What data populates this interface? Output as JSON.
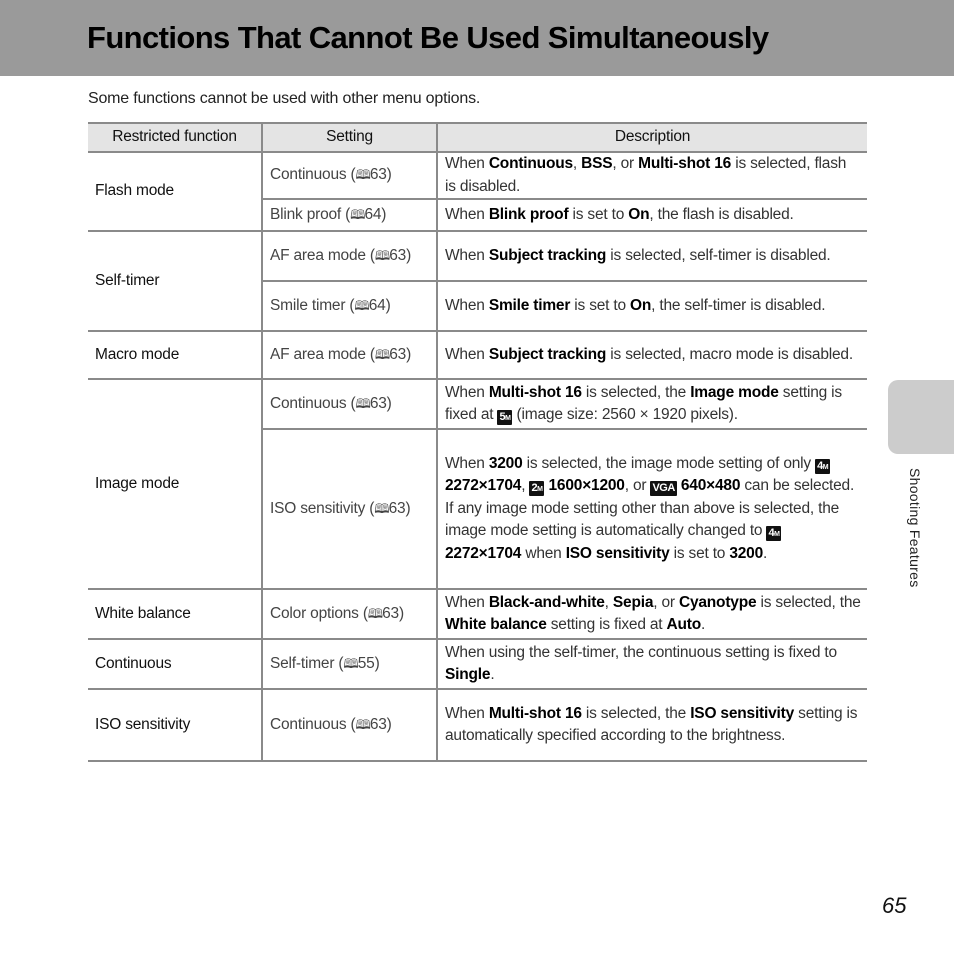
{
  "header": {
    "title": "Functions That Cannot Be Used Simultaneously"
  },
  "intro": "Some functions cannot be used with other menu options.",
  "table": {
    "columns": [
      "Restricted function",
      "Setting",
      "Description"
    ],
    "groups": [
      {
        "function": "Flash mode",
        "rows": [
          {
            "setting": "Continuous (",
            "page": "63",
            "desc_html": "When <b>Continuous</b>, <b>BSS</b>, or <b>Multi-shot 16</b> is selected, flash is disabled."
          },
          {
            "setting": "Blink proof (",
            "page": "64",
            "desc_html": "When <b>Blink proof</b> is set to <b>On</b>, the flash is disabled."
          }
        ]
      },
      {
        "function": "Self-timer",
        "rows": [
          {
            "setting": "AF area mode (",
            "page": "63",
            "desc_html": "When <b>Subject tracking</b> is selected, self-timer is disabled."
          },
          {
            "setting": "Smile timer (",
            "page": "64",
            "desc_html": "When <b>Smile timer</b> is set to <b>On</b>, the self-timer is disabled."
          }
        ]
      },
      {
        "function": "Macro mode",
        "rows": [
          {
            "setting": "AF area mode (",
            "page": "63",
            "desc_html": "When <b>Subject tracking</b> is selected, macro mode is disabled."
          }
        ]
      },
      {
        "function": "Image mode",
        "rows": [
          {
            "setting": "Continuous (",
            "page": "63",
            "desc_html": "When <b>Multi-shot 16</b> is selected, the <b>Image mode</b> setting is fixed at <span class=\"ic\" data-name=\"image-size-5m-icon\" data-interactable=\"false\">5<sub>M</sub></span> (image size: 2560 × 1920 pixels)."
          },
          {
            "setting": "ISO sensitivity (",
            "page": "63",
            "desc_html": "When <b>3200</b> is selected, the image mode setting of only <span class=\"ic\" data-name=\"image-size-4m-icon\" data-interactable=\"false\">4<sub>M</sub></span> <b>2272×1704</b>, <span class=\"ic\" data-name=\"image-size-2m-icon\" data-interactable=\"false\">2<sub>M</sub></span> <b>1600×1200</b>, or <span class=\"ic\" data-name=\"image-size-vga-icon\" data-interactable=\"false\">VGA</span> <b>640×480</b> can be selected. If any image mode setting other than above is selected, the image mode setting is automatically changed to <span class=\"ic\" data-name=\"image-size-4m-icon\" data-interactable=\"false\">4<sub>M</sub></span> <b>2272×1704</b> when <b>ISO sensitivity</b> is set to <b>3200</b>."
          }
        ]
      },
      {
        "function": "White balance",
        "rows": [
          {
            "setting": "Color options (",
            "page": "63",
            "desc_html": "When <b>Black-and-white</b>, <b>Sepia</b>, or <b>Cyanotype</b> is selected, the <b>White balance</b> setting is fixed at <b>Auto</b>."
          }
        ]
      },
      {
        "function": "Continuous",
        "rows": [
          {
            "setting": "Self-timer (",
            "page": "55",
            "desc_html": "When using the self-timer, the continuous setting is fixed to <b>Single</b>."
          }
        ]
      },
      {
        "function": "ISO sensitivity",
        "rows": [
          {
            "setting": "Continuous (",
            "page": "63",
            "desc_html": "When <b>Multi-shot 16</b> is selected, the <b>ISO sensitivity</b> setting is automatically specified according to the brightness."
          }
        ]
      }
    ],
    "book_icon_glyph": "🕮"
  },
  "side_tab": {
    "label": "Shooting Features"
  },
  "page_number": "65"
}
